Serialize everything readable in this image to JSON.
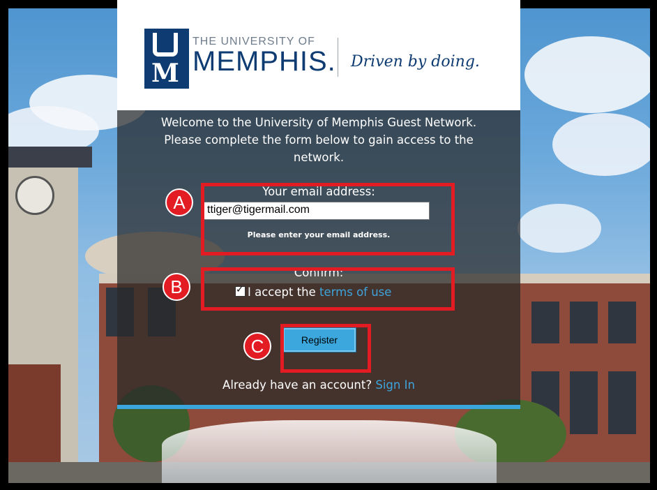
{
  "header": {
    "logo_letters": "UM",
    "university_of": "THE UNIVERSITY OF",
    "memphis": "MEMPHIS.",
    "tagline": "Driven by doing."
  },
  "welcome": {
    "line1": "Welcome to the University of Memphis Guest Network.",
    "line2": "Please complete the form below to gain access to the",
    "line3": "network."
  },
  "form": {
    "email_label": "Your email address:",
    "email_value": "ttiger@tigermail.com",
    "email_help": "Please enter your email address.",
    "confirm_label": "Confirm:",
    "accept_text": "I accept the",
    "terms_link": "terms of use",
    "accept_checked": true,
    "register_label": "Register",
    "signin_prompt": "Already have an account?",
    "signin_link": "Sign In"
  },
  "annotations": {
    "a": "A",
    "b": "B",
    "c": "C",
    "color": "#e31b23"
  },
  "colors": {
    "brand_blue": "#0d3b72",
    "accent_blue": "#3ba7dd",
    "link_blue": "#3ea5dc"
  }
}
